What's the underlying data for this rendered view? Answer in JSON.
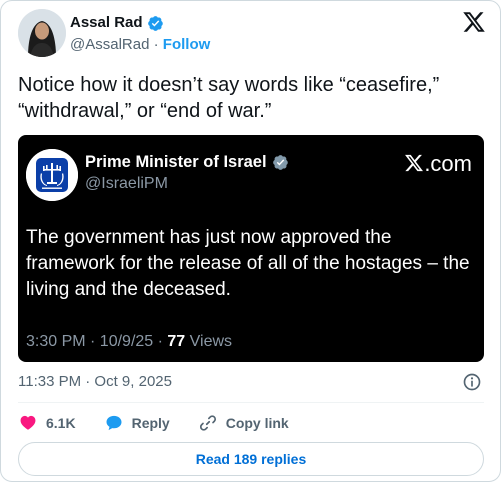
{
  "author": {
    "name": "Assal Rad",
    "handle": "@AssalRad",
    "separator": "·",
    "follow_label": "Follow"
  },
  "tweet_text": "Notice how it doesn’t say words like “ceasefire,” “withdrawal,” or “end of war.”",
  "embedded": {
    "name": "Prime Minister of Israel",
    "handle": "@IsraeliPM",
    "brand": ".com",
    "text": "The government has just now approved the framework for the release of all of the hostages – the living and the deceased.",
    "time_date": "3:30 PM · 10/9/25 · ",
    "views_count": "77",
    "views_label": " Views"
  },
  "timestamp": "11:33 PM · Oct 9, 2025",
  "actions": {
    "like_count": "6.1K",
    "reply_label": "Reply",
    "copy_link_label": "Copy link"
  },
  "read_replies_label": "Read 189 replies",
  "colors": {
    "like": "#f91880",
    "reply": "#1d9bf0",
    "verified": "#1d9bf0",
    "link": "#1d9bf0",
    "muted": "#536471"
  },
  "icons": [
    "verified-badge-icon",
    "x-logo-icon",
    "info-icon",
    "heart-icon",
    "speech-bubble-icon",
    "link-icon"
  ]
}
